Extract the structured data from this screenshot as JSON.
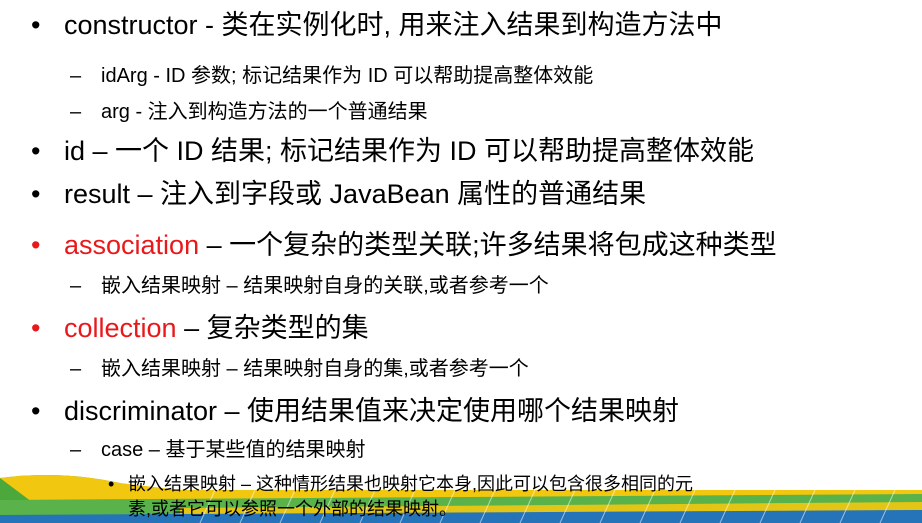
{
  "bullets": {
    "constructor": {
      "text": "constructor - 类在实例化时, 用来注入结果到构造方法中"
    },
    "constructor_sub1": {
      "text": "idArg - ID 参数; 标记结果作为 ID 可以帮助提高整体效能"
    },
    "constructor_sub2": {
      "text": "arg - 注入到构造方法的一个普通结果"
    },
    "id": {
      "keyword": "id",
      "text": " – 一个 ID 结果; 标记结果作为 ID 可以帮助提高整体效能"
    },
    "result": {
      "keyword": "result",
      "text": " – 注入到字段或 JavaBean 属性的普通结果"
    },
    "association": {
      "keyword": "association",
      "text": " – 一个复杂的类型关联;许多结果将包成这种类型"
    },
    "association_sub1": {
      "text": "嵌入结果映射 – 结果映射自身的关联,或者参考一个"
    },
    "collection": {
      "keyword": "collection",
      "text": " – 复杂类型的集"
    },
    "collection_sub1": {
      "text": "嵌入结果映射 – 结果映射自身的集,或者参考一个"
    },
    "discriminator": {
      "text": "discriminator – 使用结果值来决定使用哪个结果映射"
    },
    "discriminator_sub1": {
      "text": "case – 基于某些值的结果映射"
    },
    "discriminator_sub1_item1_line1": {
      "text": "嵌入结果映射 – 这种情形结果也映射它本身,因此可以包含很多相同的元"
    },
    "discriminator_sub1_item1_line2": {
      "text": "素,或者它可以参照一个外部的结果映射。"
    }
  },
  "markers": {
    "level1": "•",
    "level2": "–",
    "level3": "•",
    "level1_highlight_color": "#e8181b"
  },
  "colors": {
    "text": "#000000",
    "highlight": "#e8181b",
    "decor_green": "#4aa93a",
    "decor_yellow": "#f2c70f",
    "decor_blue": "#2573b8"
  }
}
